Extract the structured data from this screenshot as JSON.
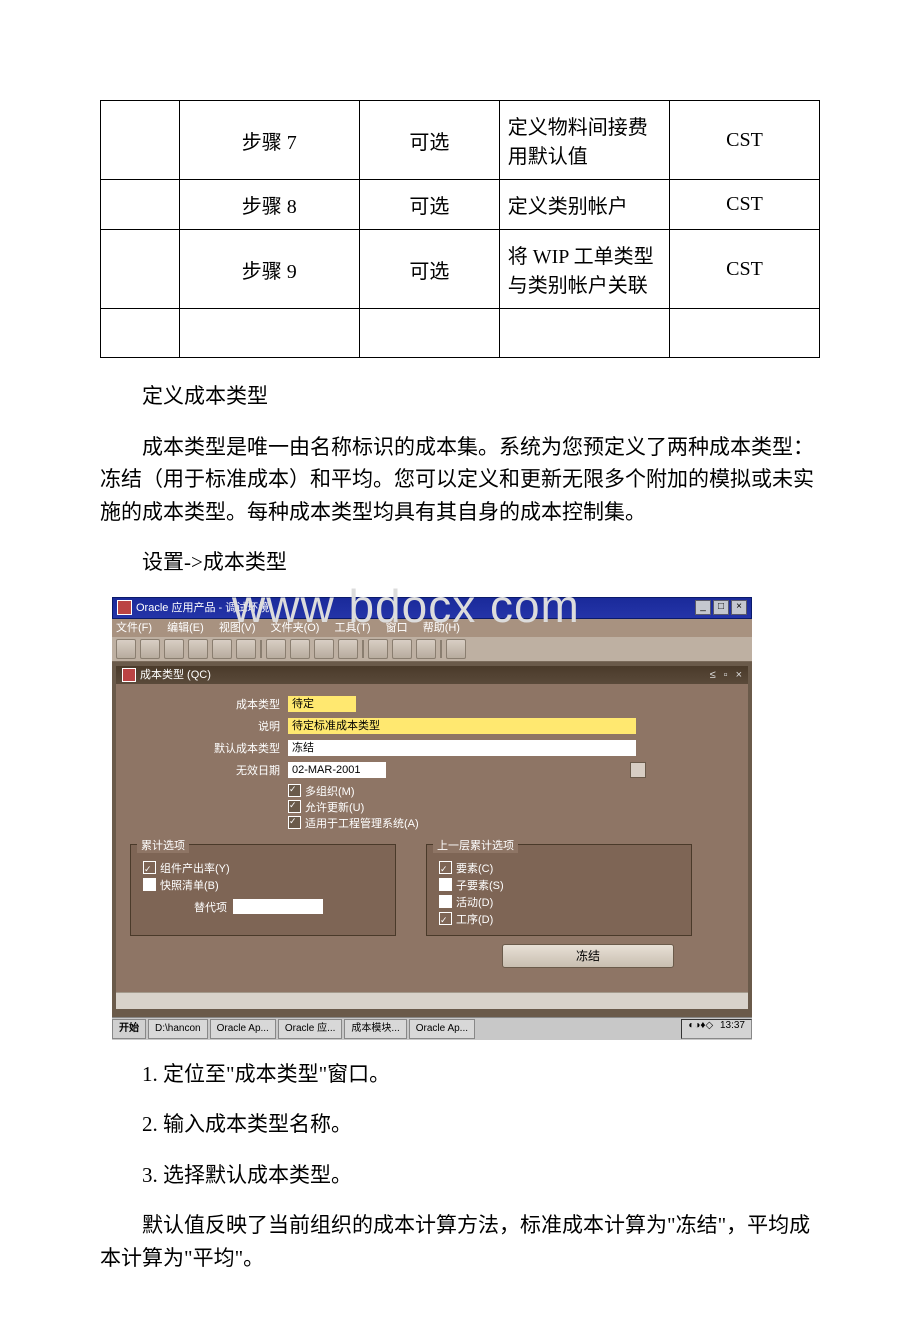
{
  "table": {
    "rows": [
      {
        "step": "步骤 7",
        "opt": "可选",
        "desc": "定义物料间接费用默认值",
        "mod": "CST"
      },
      {
        "step": "步骤 8",
        "opt": "可选",
        "desc": "定义类别帐户",
        "mod": "CST"
      },
      {
        "step": "步骤 9",
        "opt": "可选",
        "desc": "将 WIP 工单类型与类别帐户关联",
        "mod": "CST"
      }
    ]
  },
  "paras": {
    "h1": "定义成本类型",
    "p1": "成本类型是唯一由名称标识的成本集。系统为您预定义了两种成本类型：冻结（用于标准成本）和平均。您可以定义和更新无限多个附加的模拟或未实施的成本类型。每种成本类型均具有其自身的成本控制集。",
    "p2": "设置->成本类型",
    "s1": "1. 定位至\"成本类型\"窗口。",
    "s2": "2. 输入成本类型名称。",
    "s3": "3. 选择默认成本类型。",
    "p3": "默认值反映了当前组织的成本计算方法，标准成本计算为\"冻结\"，平均成本计算为\"平均\"。"
  },
  "screenshot": {
    "watermark": "www bdocx com",
    "app_title": "Oracle 应用产品 - 调试环境",
    "menu": {
      "m1": "文件(F)",
      "m2": "编辑(E)",
      "m3": "视图(V)",
      "m4": "文件夹(O)",
      "m5": "工具(T)",
      "m6": "窗口",
      "m7": "帮助(H)"
    },
    "inner_title": "成本类型 (QC)",
    "form": {
      "l1": "成本类型",
      "v1": "待定",
      "l2": "说明",
      "v2": "待定标准成本类型",
      "l3": "默认成本类型",
      "v3": "冻结",
      "l4": "无效日期",
      "v4": "02-MAR-2001",
      "cb1": "多组织(M)",
      "cb2": "允许更新(U)",
      "cb3": "适用于工程管理系统(A)"
    },
    "group1": {
      "legend": "累计选项",
      "i1": "组件产出率(Y)",
      "i2": "快照清单(B)",
      "replace_l": "替代项"
    },
    "group2": {
      "legend": "上一层累计选项",
      "i1": "要素(C)",
      "i2": "子要素(S)",
      "i3": "活动(D)",
      "i4": "工序(D)"
    },
    "button": "冻结",
    "taskbar": {
      "start": "开始",
      "t1": "D:\\hancon",
      "t2": "Oracle Ap...",
      "t3": "Oracle 应...",
      "t4": "成本模块...",
      "t5": "Oracle Ap...",
      "time": "13:37"
    }
  }
}
